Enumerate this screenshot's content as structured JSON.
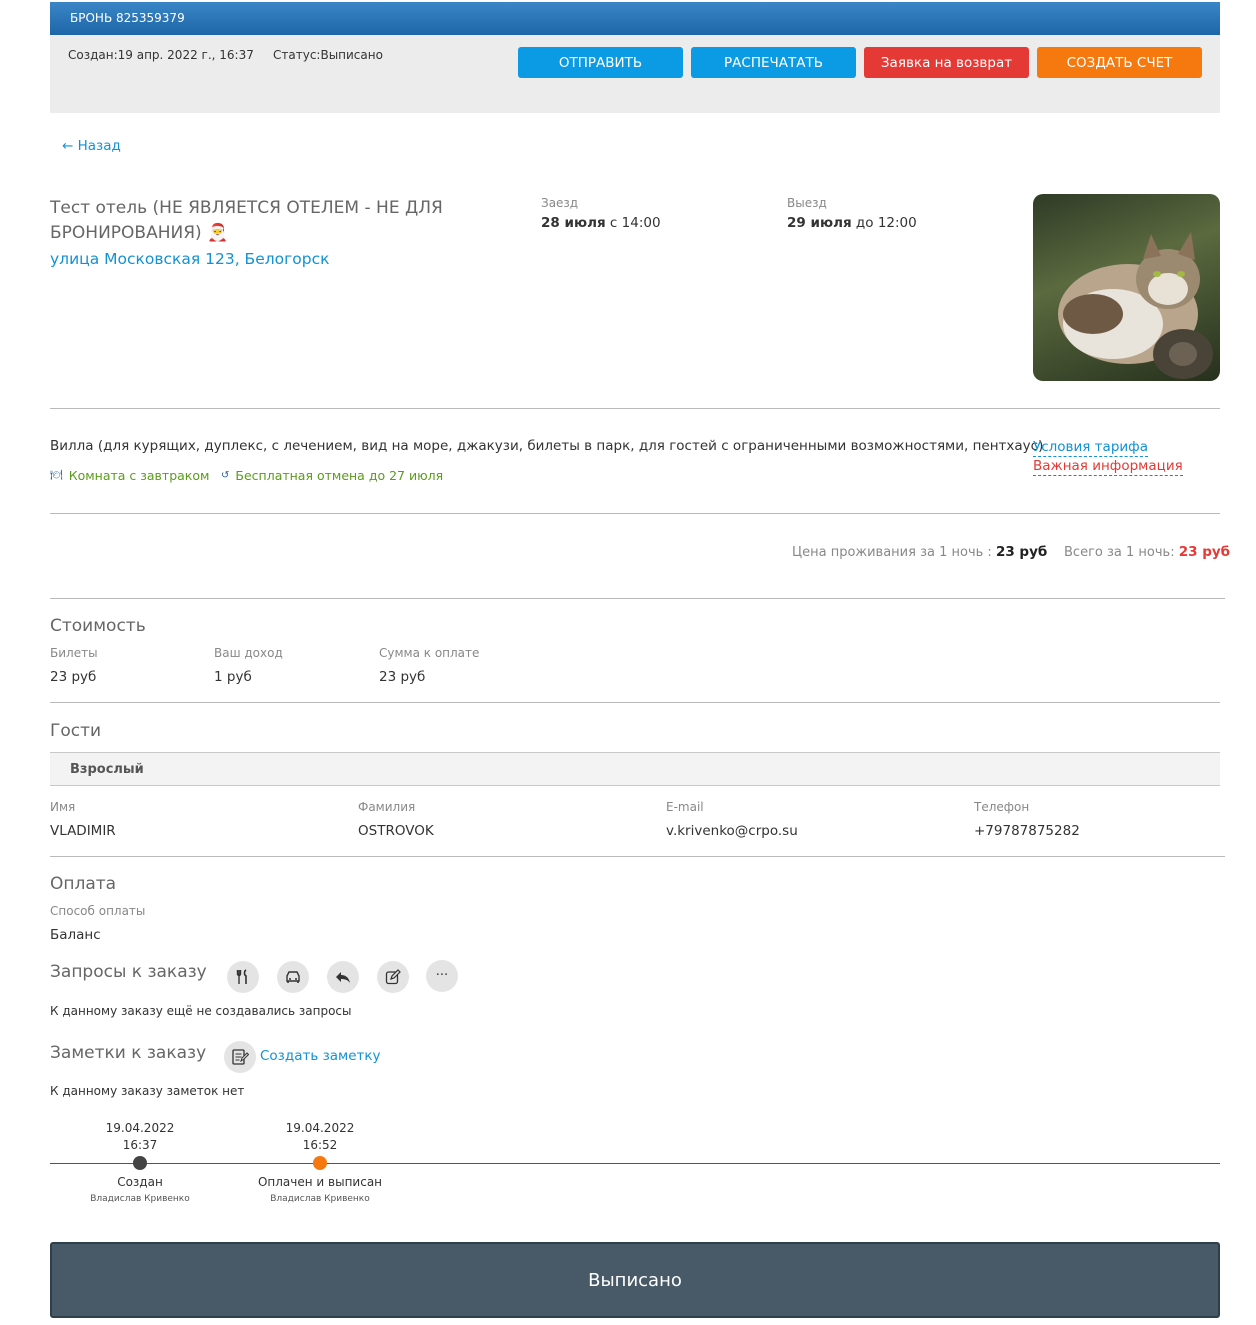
{
  "header": {
    "booking_title": "БРОНЬ 825359379",
    "created": "Создан:19 апр. 2022 г., 16:37",
    "status": "Статус:Выписано",
    "buttons": {
      "send": "ОТПРАВИТЬ",
      "print": "РАСПЕЧАТАТЬ",
      "refund": "Заявка на возврат",
      "invoice": "СОЗДАТЬ СЧЕТ"
    }
  },
  "back_link": "← Назад",
  "hotel": {
    "name": "Тест отель (НЕ ЯВЛЯЕТСЯ ОТЕЛЕМ - НЕ ДЛЯ БРОНИРОВАНИЯ) 🎅",
    "address": "улица Московская 123, Белогорск",
    "checkin_label": "Заезд",
    "checkin_date": "28 июля",
    "checkin_time": " с 14:00",
    "checkout_label": "Выезд",
    "checkout_date": "29 июля",
    "checkout_time": " до 12:00"
  },
  "room": {
    "description": "Вилла (для курящих, дуплекс, с лечением, вид на море, джакузи, билеты в парк, для гостей с ограниченными возможностями, пентхаус)",
    "breakfast": "Комната с завтраком",
    "cancellation": "Бесплатная отмена до 27 июля",
    "tariff_link": "Условия тарифа",
    "info_link": "Важная информация"
  },
  "price": {
    "per_night_label": "Цена проживания за 1 ночь : ",
    "per_night_value": "23 руб",
    "total_label": "Всего за 1 ночь: ",
    "total_value": "23 руб"
  },
  "cost": {
    "title": "Стоимость",
    "tickets_label": "Билеты",
    "tickets_value": "23 руб",
    "income_label": "Ваш доход",
    "income_value": "1 руб",
    "due_label": "Сумма к оплате",
    "due_value": "23 руб"
  },
  "guests": {
    "title": "Гости",
    "type": "Взрослый",
    "first_name_label": "Имя",
    "first_name": "VLADIMIR",
    "last_name_label": "Фамилия",
    "last_name": "OSTROVOK",
    "email_label": "E-mail",
    "email": "v.krivenko@crpo.su",
    "phone_label": "Телефон",
    "phone": "+79787875282"
  },
  "payment": {
    "title": "Оплата",
    "method_label": "Способ оплаты",
    "method": "Баланс"
  },
  "requests": {
    "title": "Запросы к заказу",
    "empty": "К данному заказу ещё не создавались запросы"
  },
  "notes": {
    "title": "Заметки к заказу",
    "create": "Создать заметку",
    "empty": "К данному заказу заметок нет"
  },
  "timeline": [
    {
      "date": "19.04.2022",
      "time": "16:37",
      "label": "Создан",
      "user": "Владислав Кривенко",
      "color": "#444444"
    },
    {
      "date": "19.04.2022",
      "time": "16:52",
      "label": "Оплачен и выписан",
      "user": "Владислав Кривенко",
      "color": "#f5790f"
    }
  ],
  "final_status": "Выписано",
  "colors": {
    "accent": "#0a9be4",
    "danger": "#e53935",
    "orange": "#f5790f",
    "link": "#1292d4",
    "green": "#5b9b1a"
  }
}
